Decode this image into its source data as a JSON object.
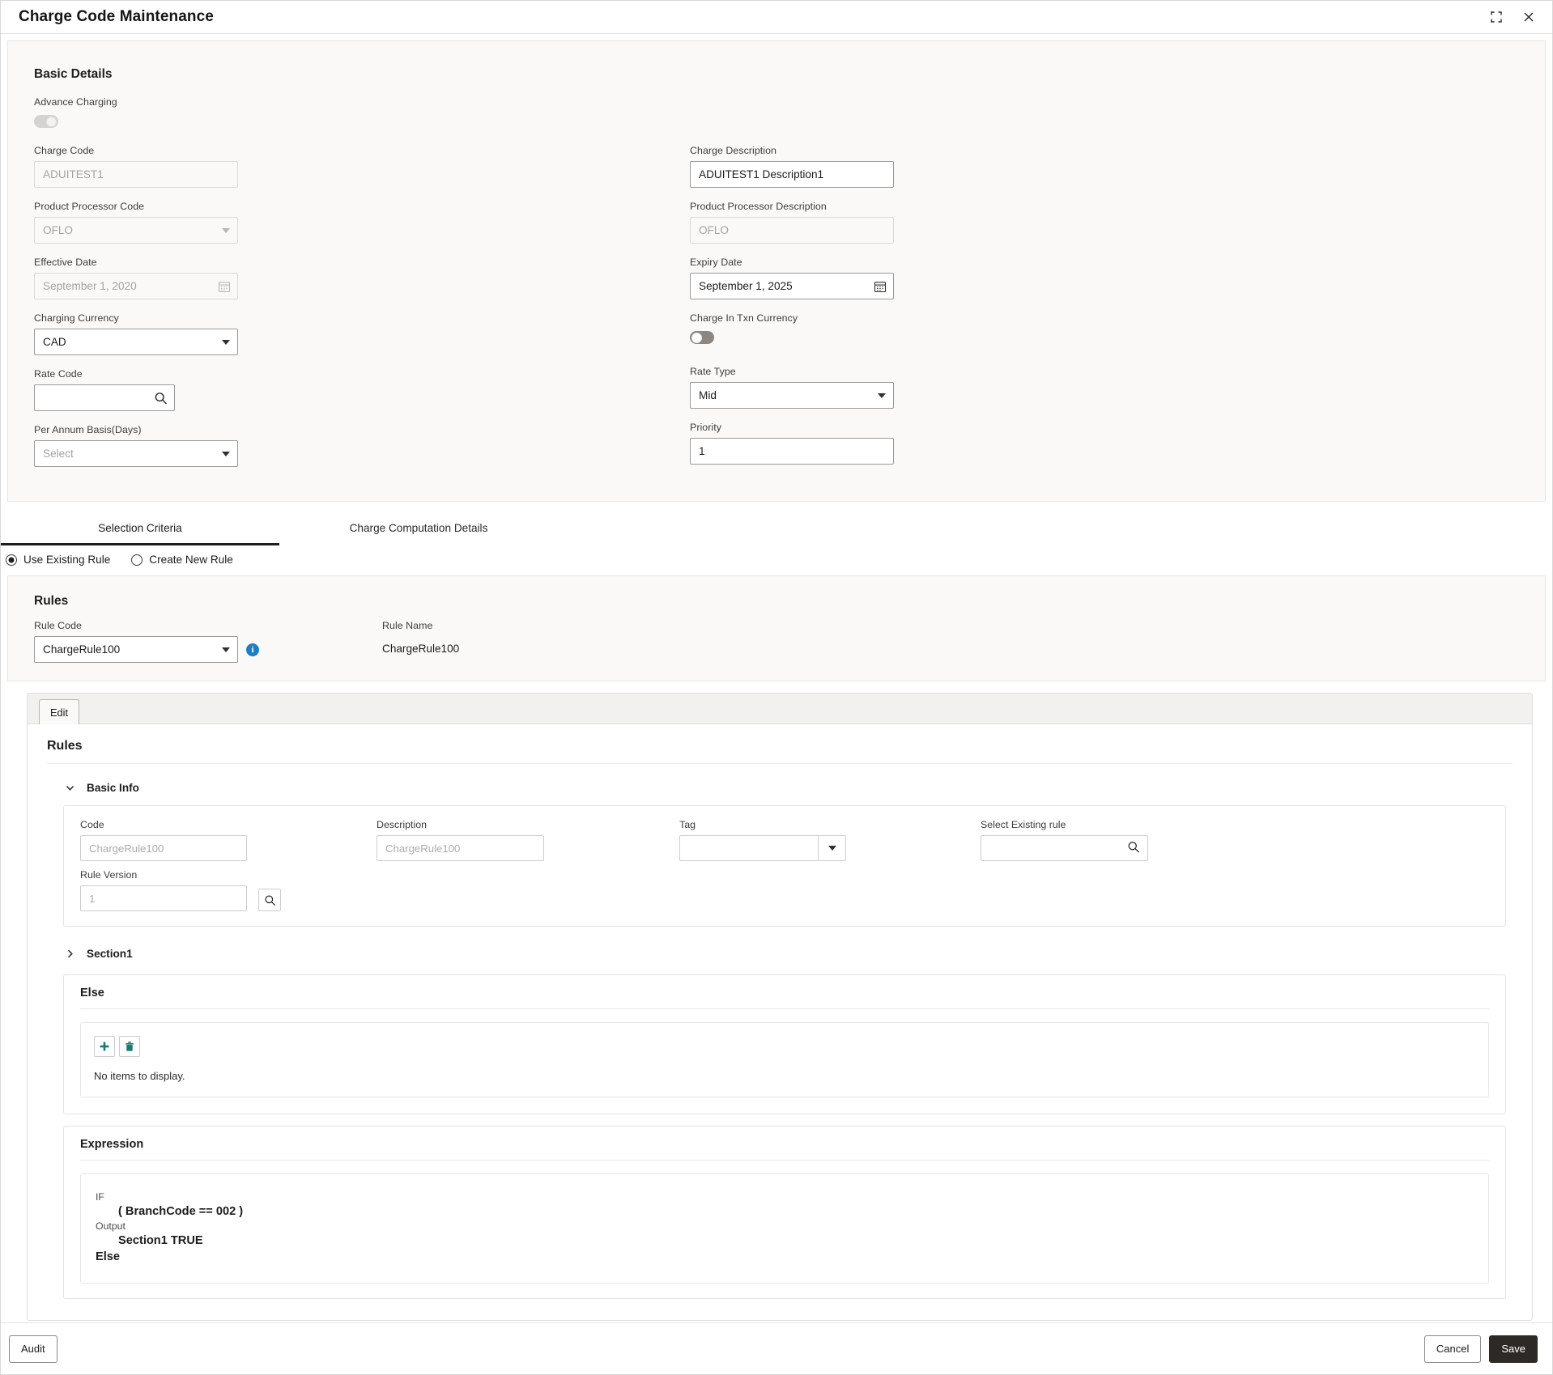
{
  "window": {
    "title": "Charge Code Maintenance",
    "restore_icon": "collapse-corners-icon",
    "close_icon": "close-icon"
  },
  "basic_details": {
    "heading": "Basic Details",
    "advance_charging": {
      "label": "Advance Charging",
      "state": "off"
    },
    "charge_code": {
      "label": "Charge Code",
      "value": "ADUITEST1",
      "disabled": true
    },
    "charge_description": {
      "label": "Charge Description",
      "value": "ADUITEST1 Description1",
      "disabled": false
    },
    "product_processor_code": {
      "label": "Product Processor Code",
      "value": "OFLO",
      "disabled": true
    },
    "product_processor_description": {
      "label": "Product Processor Description",
      "value": "OFLO",
      "disabled": true
    },
    "effective_date": {
      "label": "Effective Date",
      "value": "September 1, 2020",
      "disabled": true
    },
    "expiry_date": {
      "label": "Expiry Date",
      "value": "September 1, 2025",
      "disabled": false
    },
    "charging_currency": {
      "label": "Charging Currency",
      "value": "CAD"
    },
    "charge_in_txn_currency": {
      "label": "Charge In Txn Currency",
      "state": "off"
    },
    "rate_code": {
      "label": "Rate Code",
      "value": ""
    },
    "rate_type": {
      "label": "Rate Type",
      "value": "Mid"
    },
    "per_annum_basis": {
      "label": "Per Annum Basis(Days)",
      "value": "Select"
    },
    "priority": {
      "label": "Priority",
      "value": "1"
    }
  },
  "tabs": [
    {
      "label": "Selection Criteria",
      "active": true
    },
    {
      "label": "Charge Computation Details",
      "active": false
    }
  ],
  "rule_mode": {
    "use_existing": {
      "label": "Use Existing Rule",
      "checked": true
    },
    "create_new": {
      "label": "Create New Rule",
      "checked": false
    }
  },
  "rules": {
    "heading": "Rules",
    "rule_code": {
      "label": "Rule Code",
      "value": "ChargeRule100"
    },
    "rule_name": {
      "label": "Rule Name",
      "value": "ChargeRule100"
    }
  },
  "editor": {
    "edit_button": "Edit",
    "title": "Rules",
    "basic_info": {
      "label": "Basic Info",
      "expanded": true,
      "code": {
        "label": "Code",
        "value": "ChargeRule100"
      },
      "description": {
        "label": "Description",
        "value": "ChargeRule100"
      },
      "tag": {
        "label": "Tag",
        "value": ""
      },
      "select_existing_rule": {
        "label": "Select Existing rule",
        "value": ""
      },
      "rule_version": {
        "label": "Rule Version",
        "value": "1"
      }
    },
    "section1": {
      "label": "Section1",
      "expanded": false
    },
    "else_block": {
      "title": "Else",
      "add_icon": "plus-icon",
      "delete_icon": "trash-icon",
      "empty_text": "No items to display."
    },
    "expression": {
      "title": "Expression",
      "if_keyword": "IF",
      "condition": "( BranchCode == 002 )",
      "output_keyword": "Output",
      "output_value": "Section1 TRUE",
      "else_keyword": "Else"
    }
  },
  "footer": {
    "audit": "Audit",
    "cancel": "Cancel",
    "save": "Save"
  },
  "colors": {
    "accent_teal": "#1a7a70",
    "info_blue": "#1c7fc4",
    "primary_dark": "#2d2a26",
    "panel_bg": "#faf9f8"
  }
}
